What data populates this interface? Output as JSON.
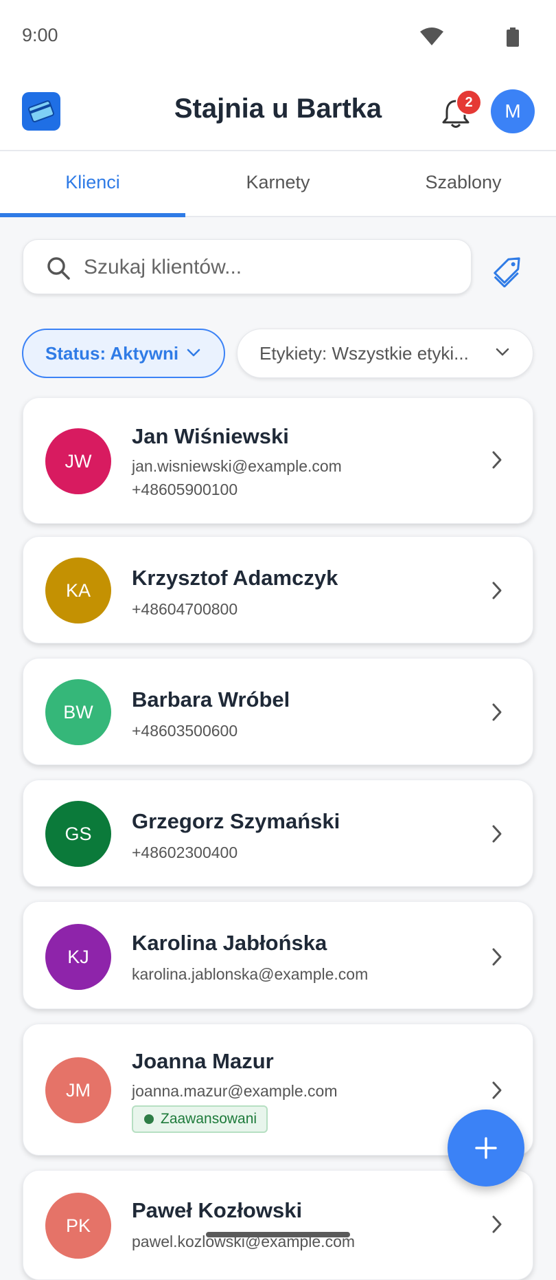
{
  "status_bar": {
    "time": "9:00"
  },
  "app_bar": {
    "title": "Stajnia u Bartka",
    "notification_count": "2",
    "user_initial": "M"
  },
  "tabs": [
    {
      "label": "Klienci",
      "active": true
    },
    {
      "label": "Karnety",
      "active": false
    },
    {
      "label": "Szablony",
      "active": false
    }
  ],
  "search": {
    "placeholder": "Szukaj klientów..."
  },
  "filters": {
    "status_label": "Status: Aktywni",
    "tags_label": "Etykiety: Wszystkie etyki..."
  },
  "clients": [
    {
      "initials": "JW",
      "name": "Jan Wiśniewski",
      "email": "jan.wisniewski@example.com",
      "phone": "+48605900100",
      "avatar_color": "#d81b60"
    },
    {
      "initials": "KA",
      "name": "Krzysztof Adamczyk",
      "phone": "+48604700800",
      "avatar_color": "#c49102"
    },
    {
      "initials": "BW",
      "name": "Barbara Wróbel",
      "phone": "+48603500600",
      "avatar_color": "#35b779"
    },
    {
      "initials": "GS",
      "name": "Grzegorz Szymański",
      "phone": "+48602300400",
      "avatar_color": "#0b7a3a"
    },
    {
      "initials": "KJ",
      "name": "Karolina Jabłońska",
      "email": "karolina.jablonska@example.com",
      "avatar_color": "#8e24aa"
    },
    {
      "initials": "JM",
      "name": "Joanna Mazur",
      "email": "joanna.mazur@example.com",
      "tag": "Zaawansowani",
      "avatar_color": "#e57368"
    },
    {
      "initials": "PK",
      "name": "Paweł Kozłowski",
      "email": "pawel.kozlowski@example.com",
      "avatar_color": "#e57368"
    }
  ],
  "colors": {
    "accent": "#3b82f6",
    "tab_active": "#2f7be6",
    "badge": "#e53935",
    "tag_green": "#2e7d46"
  },
  "icons": {
    "wifi": "wifi-icon",
    "battery": "battery-icon",
    "logo": "card-logo-icon",
    "bell": "bell-icon",
    "search": "search-icon",
    "tag": "tag-icon",
    "chevron_down": "chevron-down-icon",
    "chevron_right": "chevron-right-icon",
    "plus": "plus-icon"
  }
}
